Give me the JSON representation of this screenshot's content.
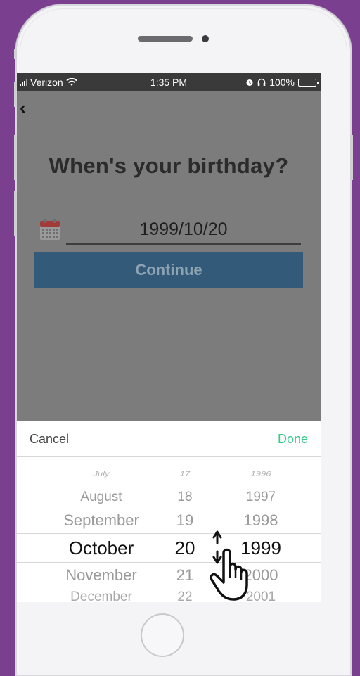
{
  "status_bar": {
    "carrier": "Verizon",
    "time": "1:35 PM",
    "battery": "100%"
  },
  "screen": {
    "title": "When's your birthday?",
    "date_value": "1999/10/20",
    "continue_label": "Continue"
  },
  "picker": {
    "cancel_label": "Cancel",
    "done_label": "Done",
    "months": [
      "July",
      "August",
      "September",
      "October",
      "November",
      "December"
    ],
    "days": [
      "17",
      "18",
      "19",
      "20",
      "21",
      "22"
    ],
    "years": [
      "1996",
      "1997",
      "1998",
      "1999",
      "2000",
      "2001"
    ],
    "selected": {
      "month": "October",
      "day": "20",
      "year": "1999"
    }
  },
  "colors": {
    "background": "#7a3f8e",
    "accent_done": "#39c98a",
    "button": "#335a78",
    "overlay": "#7c7c7c"
  },
  "icons": [
    "back-chevron-icon",
    "calendar-icon",
    "wifi-icon",
    "alarm-icon",
    "headphones-icon",
    "battery-icon",
    "pointer-hand-icon"
  ]
}
